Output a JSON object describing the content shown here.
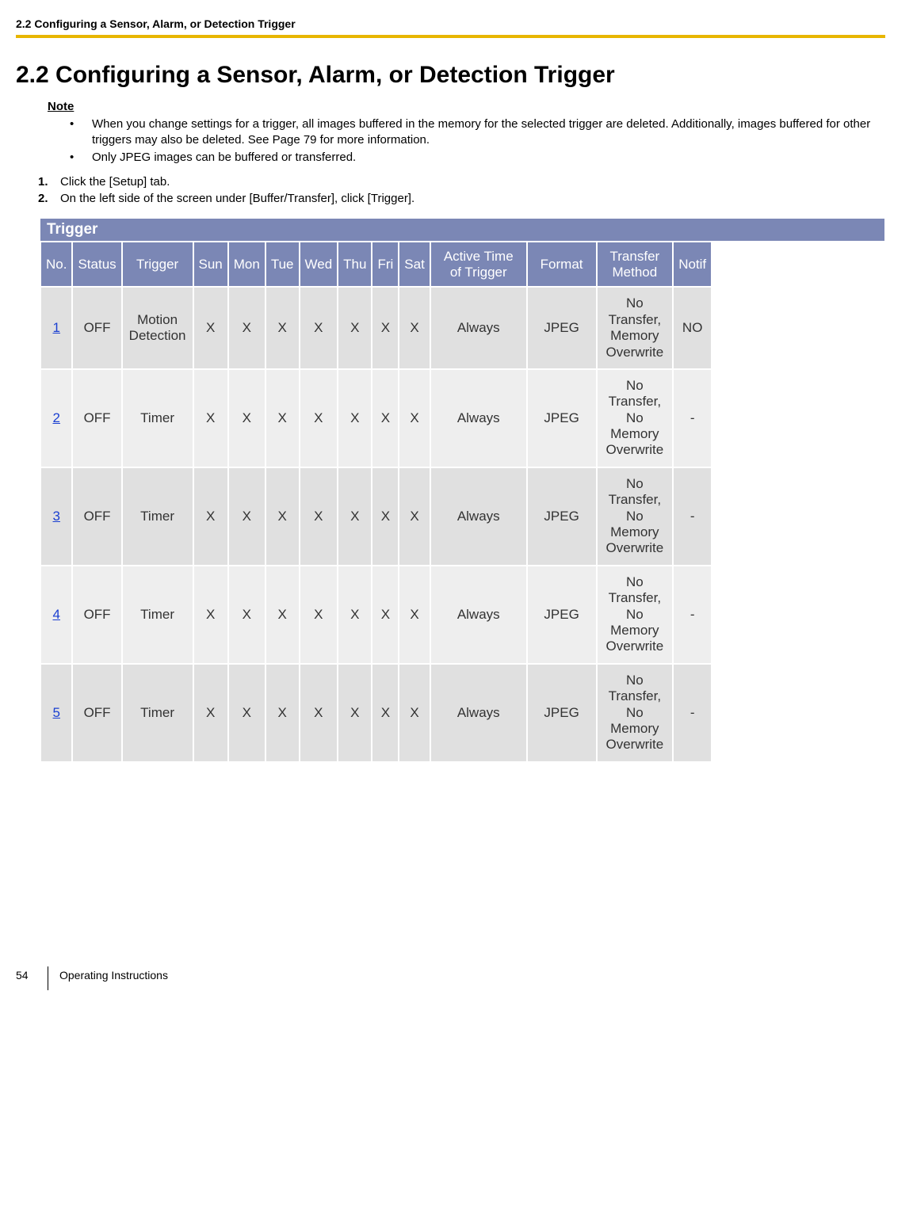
{
  "header": {
    "running": "2.2 Configuring a Sensor, Alarm, or Detection Trigger"
  },
  "title": "2.2  Configuring a Sensor, Alarm, or Detection Trigger",
  "note": {
    "label": "Note",
    "items": [
      "When you change settings for a trigger, all images buffered in the memory for the selected trigger are deleted. Additionally, images buffered for other triggers may also be deleted. See Page 79 for more information.",
      "Only JPEG images can be buffered or transferred."
    ]
  },
  "steps": [
    "Click the [Setup] tab.",
    "On the left side of the screen under [Buffer/Transfer], click [Trigger]."
  ],
  "table": {
    "caption": "Trigger",
    "columns": {
      "no": "No.",
      "status": "Status",
      "trigger": "Trigger",
      "sun": "Sun",
      "mon": "Mon",
      "tue": "Tue",
      "wed": "Wed",
      "thu": "Thu",
      "fri": "Fri",
      "sat": "Sat",
      "active": "Active Time\nof Trigger",
      "format": "Format",
      "transfer": "Transfer\nMethod",
      "notify": "Notif"
    },
    "rows": [
      {
        "no": "1",
        "status": "OFF",
        "trigger": "Motion\nDetection",
        "sun": "X",
        "mon": "X",
        "tue": "X",
        "wed": "X",
        "thu": "X",
        "fri": "X",
        "sat": "X",
        "active": "Always",
        "format": "JPEG",
        "transfer": "No\nTransfer,\nMemory\nOverwrite",
        "notify": "NO"
      },
      {
        "no": "2",
        "status": "OFF",
        "trigger": "Timer",
        "sun": "X",
        "mon": "X",
        "tue": "X",
        "wed": "X",
        "thu": "X",
        "fri": "X",
        "sat": "X",
        "active": "Always",
        "format": "JPEG",
        "transfer": "No\nTransfer,\nNo\nMemory\nOverwrite",
        "notify": "-"
      },
      {
        "no": "3",
        "status": "OFF",
        "trigger": "Timer",
        "sun": "X",
        "mon": "X",
        "tue": "X",
        "wed": "X",
        "thu": "X",
        "fri": "X",
        "sat": "X",
        "active": "Always",
        "format": "JPEG",
        "transfer": "No\nTransfer,\nNo\nMemory\nOverwrite",
        "notify": "-"
      },
      {
        "no": "4",
        "status": "OFF",
        "trigger": "Timer",
        "sun": "X",
        "mon": "X",
        "tue": "X",
        "wed": "X",
        "thu": "X",
        "fri": "X",
        "sat": "X",
        "active": "Always",
        "format": "JPEG",
        "transfer": "No\nTransfer,\nNo\nMemory\nOverwrite",
        "notify": "-"
      },
      {
        "no": "5",
        "status": "OFF",
        "trigger": "Timer",
        "sun": "X",
        "mon": "X",
        "tue": "X",
        "wed": "X",
        "thu": "X",
        "fri": "X",
        "sat": "X",
        "active": "Always",
        "format": "JPEG",
        "transfer": "No\nTransfer,\nNo\nMemory\nOverwrite",
        "notify": "-"
      }
    ]
  },
  "footer": {
    "page": "54",
    "label": "Operating Instructions"
  }
}
